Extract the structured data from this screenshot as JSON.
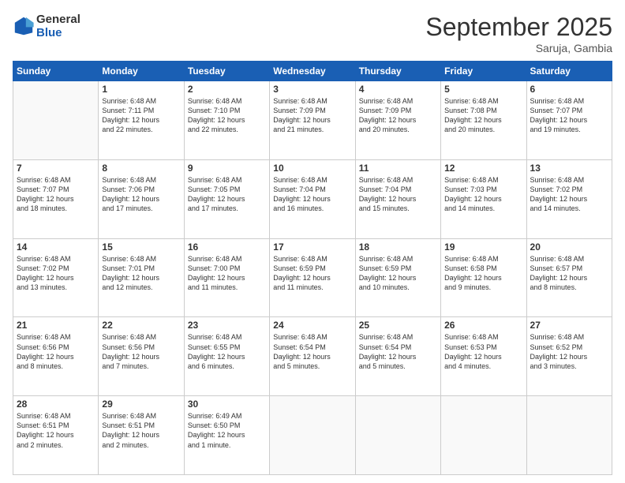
{
  "logo": {
    "line1": "General",
    "line2": "Blue"
  },
  "title": "September 2025",
  "subtitle": "Saruja, Gambia",
  "days_of_week": [
    "Sunday",
    "Monday",
    "Tuesday",
    "Wednesday",
    "Thursday",
    "Friday",
    "Saturday"
  ],
  "weeks": [
    [
      {
        "day": "",
        "info": ""
      },
      {
        "day": "1",
        "info": "Sunrise: 6:48 AM\nSunset: 7:11 PM\nDaylight: 12 hours\nand 22 minutes."
      },
      {
        "day": "2",
        "info": "Sunrise: 6:48 AM\nSunset: 7:10 PM\nDaylight: 12 hours\nand 22 minutes."
      },
      {
        "day": "3",
        "info": "Sunrise: 6:48 AM\nSunset: 7:09 PM\nDaylight: 12 hours\nand 21 minutes."
      },
      {
        "day": "4",
        "info": "Sunrise: 6:48 AM\nSunset: 7:09 PM\nDaylight: 12 hours\nand 20 minutes."
      },
      {
        "day": "5",
        "info": "Sunrise: 6:48 AM\nSunset: 7:08 PM\nDaylight: 12 hours\nand 20 minutes."
      },
      {
        "day": "6",
        "info": "Sunrise: 6:48 AM\nSunset: 7:07 PM\nDaylight: 12 hours\nand 19 minutes."
      }
    ],
    [
      {
        "day": "7",
        "info": "Sunrise: 6:48 AM\nSunset: 7:07 PM\nDaylight: 12 hours\nand 18 minutes."
      },
      {
        "day": "8",
        "info": "Sunrise: 6:48 AM\nSunset: 7:06 PM\nDaylight: 12 hours\nand 17 minutes."
      },
      {
        "day": "9",
        "info": "Sunrise: 6:48 AM\nSunset: 7:05 PM\nDaylight: 12 hours\nand 17 minutes."
      },
      {
        "day": "10",
        "info": "Sunrise: 6:48 AM\nSunset: 7:04 PM\nDaylight: 12 hours\nand 16 minutes."
      },
      {
        "day": "11",
        "info": "Sunrise: 6:48 AM\nSunset: 7:04 PM\nDaylight: 12 hours\nand 15 minutes."
      },
      {
        "day": "12",
        "info": "Sunrise: 6:48 AM\nSunset: 7:03 PM\nDaylight: 12 hours\nand 14 minutes."
      },
      {
        "day": "13",
        "info": "Sunrise: 6:48 AM\nSunset: 7:02 PM\nDaylight: 12 hours\nand 14 minutes."
      }
    ],
    [
      {
        "day": "14",
        "info": "Sunrise: 6:48 AM\nSunset: 7:02 PM\nDaylight: 12 hours\nand 13 minutes."
      },
      {
        "day": "15",
        "info": "Sunrise: 6:48 AM\nSunset: 7:01 PM\nDaylight: 12 hours\nand 12 minutes."
      },
      {
        "day": "16",
        "info": "Sunrise: 6:48 AM\nSunset: 7:00 PM\nDaylight: 12 hours\nand 11 minutes."
      },
      {
        "day": "17",
        "info": "Sunrise: 6:48 AM\nSunset: 6:59 PM\nDaylight: 12 hours\nand 11 minutes."
      },
      {
        "day": "18",
        "info": "Sunrise: 6:48 AM\nSunset: 6:59 PM\nDaylight: 12 hours\nand 10 minutes."
      },
      {
        "day": "19",
        "info": "Sunrise: 6:48 AM\nSunset: 6:58 PM\nDaylight: 12 hours\nand 9 minutes."
      },
      {
        "day": "20",
        "info": "Sunrise: 6:48 AM\nSunset: 6:57 PM\nDaylight: 12 hours\nand 8 minutes."
      }
    ],
    [
      {
        "day": "21",
        "info": "Sunrise: 6:48 AM\nSunset: 6:56 PM\nDaylight: 12 hours\nand 8 minutes."
      },
      {
        "day": "22",
        "info": "Sunrise: 6:48 AM\nSunset: 6:56 PM\nDaylight: 12 hours\nand 7 minutes."
      },
      {
        "day": "23",
        "info": "Sunrise: 6:48 AM\nSunset: 6:55 PM\nDaylight: 12 hours\nand 6 minutes."
      },
      {
        "day": "24",
        "info": "Sunrise: 6:48 AM\nSunset: 6:54 PM\nDaylight: 12 hours\nand 5 minutes."
      },
      {
        "day": "25",
        "info": "Sunrise: 6:48 AM\nSunset: 6:54 PM\nDaylight: 12 hours\nand 5 minutes."
      },
      {
        "day": "26",
        "info": "Sunrise: 6:48 AM\nSunset: 6:53 PM\nDaylight: 12 hours\nand 4 minutes."
      },
      {
        "day": "27",
        "info": "Sunrise: 6:48 AM\nSunset: 6:52 PM\nDaylight: 12 hours\nand 3 minutes."
      }
    ],
    [
      {
        "day": "28",
        "info": "Sunrise: 6:48 AM\nSunset: 6:51 PM\nDaylight: 12 hours\nand 2 minutes."
      },
      {
        "day": "29",
        "info": "Sunrise: 6:48 AM\nSunset: 6:51 PM\nDaylight: 12 hours\nand 2 minutes."
      },
      {
        "day": "30",
        "info": "Sunrise: 6:49 AM\nSunset: 6:50 PM\nDaylight: 12 hours\nand 1 minute."
      },
      {
        "day": "",
        "info": ""
      },
      {
        "day": "",
        "info": ""
      },
      {
        "day": "",
        "info": ""
      },
      {
        "day": "",
        "info": ""
      }
    ]
  ]
}
